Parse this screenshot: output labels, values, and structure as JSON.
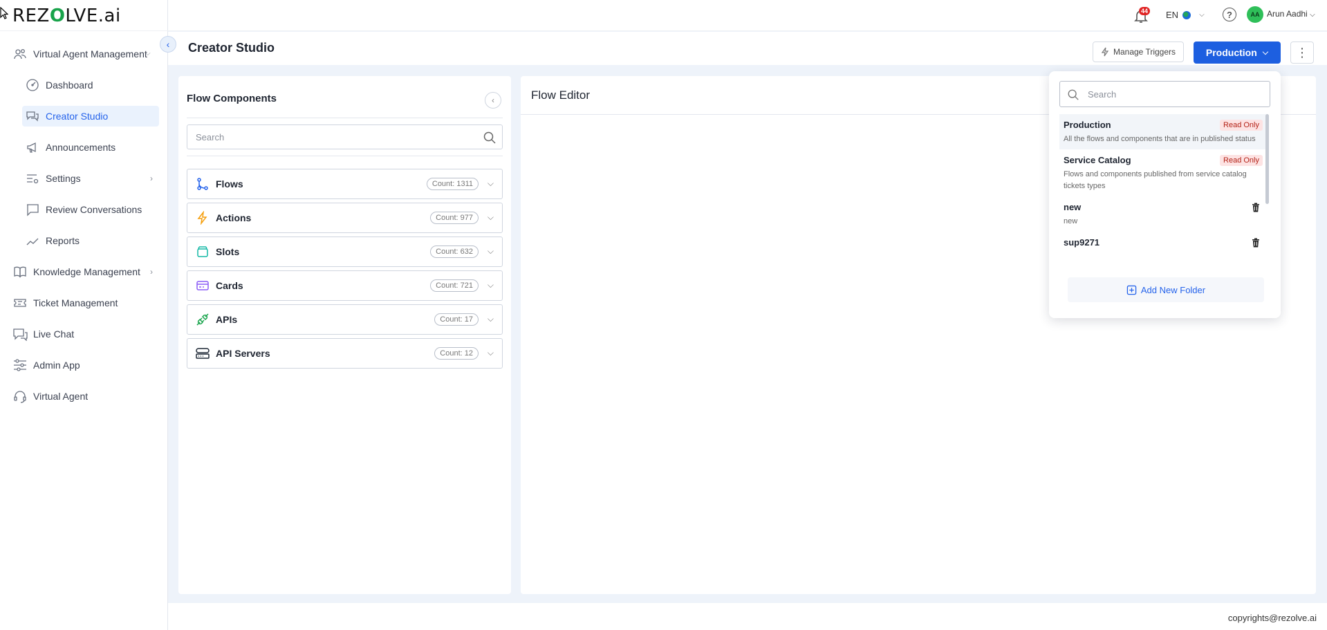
{
  "app": {
    "logo_text_before": "REZ",
    "logo_text_v": "O",
    "logo_text_after": "LVE.ai"
  },
  "sidebar": {
    "items": [
      {
        "label": "Virtual Agent Management",
        "icon": "users-icon",
        "level": "top",
        "expandable": true
      },
      {
        "label": "Dashboard",
        "icon": "gauge-icon",
        "level": "sub"
      },
      {
        "label": "Creator Studio",
        "icon": "chat-bubbles-icon",
        "level": "sub",
        "active": true
      },
      {
        "label": "Announcements",
        "icon": "megaphone-icon",
        "level": "sub"
      },
      {
        "label": "Settings",
        "icon": "settings-sliders-icon",
        "level": "sub",
        "expandable": true
      },
      {
        "label": "Review Conversations",
        "icon": "review-chat-icon",
        "level": "sub"
      },
      {
        "label": "Reports",
        "icon": "line-chart-icon",
        "level": "sub"
      },
      {
        "label": "Knowledge Management",
        "icon": "book-icon",
        "level": "top",
        "expandable": true
      },
      {
        "label": "Ticket Management",
        "icon": "ticket-icon",
        "level": "top"
      },
      {
        "label": "Live Chat",
        "icon": "live-chat-icon",
        "level": "top"
      },
      {
        "label": "Admin App",
        "icon": "sliders-icon",
        "level": "top"
      },
      {
        "label": "Virtual Agent",
        "icon": "headset-icon",
        "level": "top"
      }
    ]
  },
  "topbar": {
    "notification_count": "44",
    "language": "EN",
    "avatar_initials": "AA",
    "user_name": "Arun Aadhi"
  },
  "header": {
    "title": "Creator Studio",
    "manage_triggers_label": "Manage Triggers",
    "environment_label": "Production"
  },
  "flow_components": {
    "title": "Flow Components",
    "search_placeholder": "Search",
    "items": [
      {
        "label": "Flows",
        "count": "Count: 1311",
        "icon": "flow-branch-icon",
        "color": "#2563eb"
      },
      {
        "label": "Actions",
        "count": "Count: 977",
        "icon": "lightning-icon",
        "color": "#f59e0b"
      },
      {
        "label": "Slots",
        "count": "Count: 632",
        "icon": "slots-icon",
        "color": "#14b8a6"
      },
      {
        "label": "Cards",
        "count": "Count: 721",
        "icon": "card-icon",
        "color": "#8b5cf6"
      },
      {
        "label": "APIs",
        "count": "Count: 17",
        "icon": "plug-icon",
        "color": "#16a34a"
      },
      {
        "label": "API Servers",
        "count": "Count: 12",
        "icon": "server-icon",
        "color": "#1f2937"
      }
    ]
  },
  "flow_editor": {
    "title": "Flow Editor"
  },
  "environment_dropdown": {
    "search_placeholder": "Search",
    "items": [
      {
        "name": "Production",
        "badge": "Read Only",
        "description": "All the flows and components that are in published status"
      },
      {
        "name": "Service Catalog",
        "badge": "Read Only",
        "description": "Flows and components published from service catalog tickets types"
      },
      {
        "name": "new",
        "description": "new",
        "deletable": true
      },
      {
        "name": "sup9271",
        "deletable": true
      }
    ],
    "add_folder_label": "Add New Folder"
  },
  "footer": {
    "text": "copyrights@rezolve.ai"
  },
  "colors": {
    "accent": "#2563eb",
    "primary_button": "#1d5fe0",
    "badge_red": "#e02424",
    "read_only_bg": "#fde3e3",
    "read_only_text": "#b42318"
  }
}
